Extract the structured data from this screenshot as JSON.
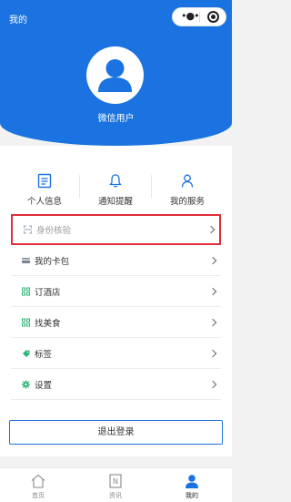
{
  "nav": {
    "title": "我的"
  },
  "user": {
    "name": "微信用户"
  },
  "quick_actions": [
    {
      "label": "个人信息",
      "icon": "id-card-icon"
    },
    {
      "label": "通知提醒",
      "icon": "bell-icon"
    },
    {
      "label": "我的服务",
      "icon": "person-icon"
    }
  ],
  "menu": [
    {
      "label": "身份核验",
      "icon": "scan-icon"
    },
    {
      "label": "我的卡包",
      "icon": "card-icon"
    },
    {
      "label": "订酒店",
      "icon": "grid-icon"
    },
    {
      "label": "找美食",
      "icon": "grid-icon"
    },
    {
      "label": "标签",
      "icon": "tag-icon"
    },
    {
      "label": "设置",
      "icon": "gear-icon"
    }
  ],
  "logout": {
    "label": "退出登录"
  },
  "tabbar": [
    {
      "label": "首页",
      "icon": "home-icon"
    },
    {
      "label": "资讯",
      "icon": "news-icon"
    },
    {
      "label": "我的",
      "icon": "user-icon"
    }
  ],
  "colors": {
    "brand": "#1a73e0",
    "highlight_border": "#e0303b"
  }
}
